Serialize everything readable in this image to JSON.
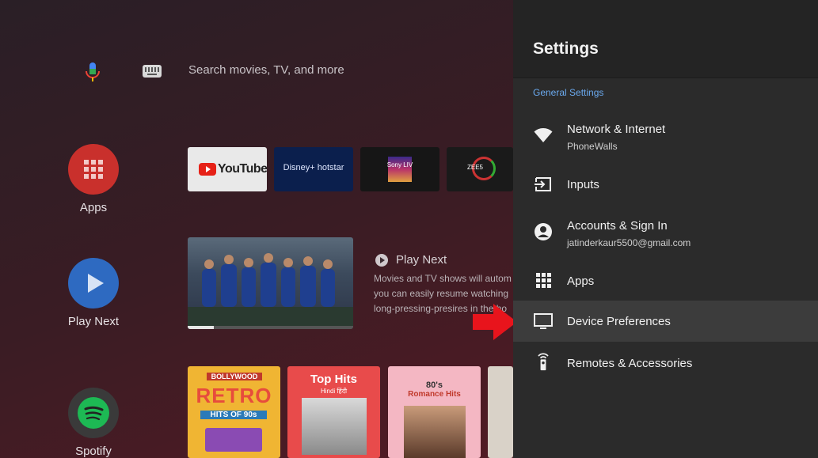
{
  "search": {
    "placeholder": "Search movies, TV, and more"
  },
  "sidebar": [
    {
      "label": "Apps",
      "color": "#c9302c"
    },
    {
      "label": "Play Next",
      "color": "#2e6ac1"
    },
    {
      "label": "Spotify",
      "color": "#3a3a3a"
    }
  ],
  "channels": [
    {
      "name": "YouTube"
    },
    {
      "name": "Disney+ hotstar"
    },
    {
      "name": "Sony LIV"
    },
    {
      "name": "ZEE5"
    }
  ],
  "play_next": {
    "title": "Play Next",
    "desc_line1": "Movies and TV shows will autom",
    "desc_line2": "you can easily resume watching",
    "desc_line3": "long-pressing-presires in the ho",
    "progress": 0.16
  },
  "music_tiles": [
    {
      "line1": "BOLLYWOOD",
      "line2": "RETRO",
      "line3": "HITS OF 90s"
    },
    {
      "line1": "Top Hits",
      "line2": "Hindi हिंदी"
    },
    {
      "line1": "80's",
      "line2": "Romance Hits"
    }
  ],
  "settings": {
    "title": "Settings",
    "section": "General Settings",
    "items": [
      {
        "label": "Network & Internet",
        "sub": "PhoneWalls",
        "icon": "wifi-icon"
      },
      {
        "label": "Inputs",
        "icon": "input-icon"
      },
      {
        "label": "Accounts & Sign In",
        "sub": "jatinderkaur5500@gmail.com",
        "icon": "account-icon"
      },
      {
        "label": "Apps",
        "icon": "apps-grid-icon"
      },
      {
        "label": "Device Preferences",
        "icon": "tv-icon",
        "selected": true
      },
      {
        "label": "Remotes & Accessories",
        "icon": "remote-icon"
      }
    ]
  },
  "colors": {
    "accent": "#6aa9ee",
    "arrow": "#e8141c",
    "panel": "#2b2b2b"
  }
}
